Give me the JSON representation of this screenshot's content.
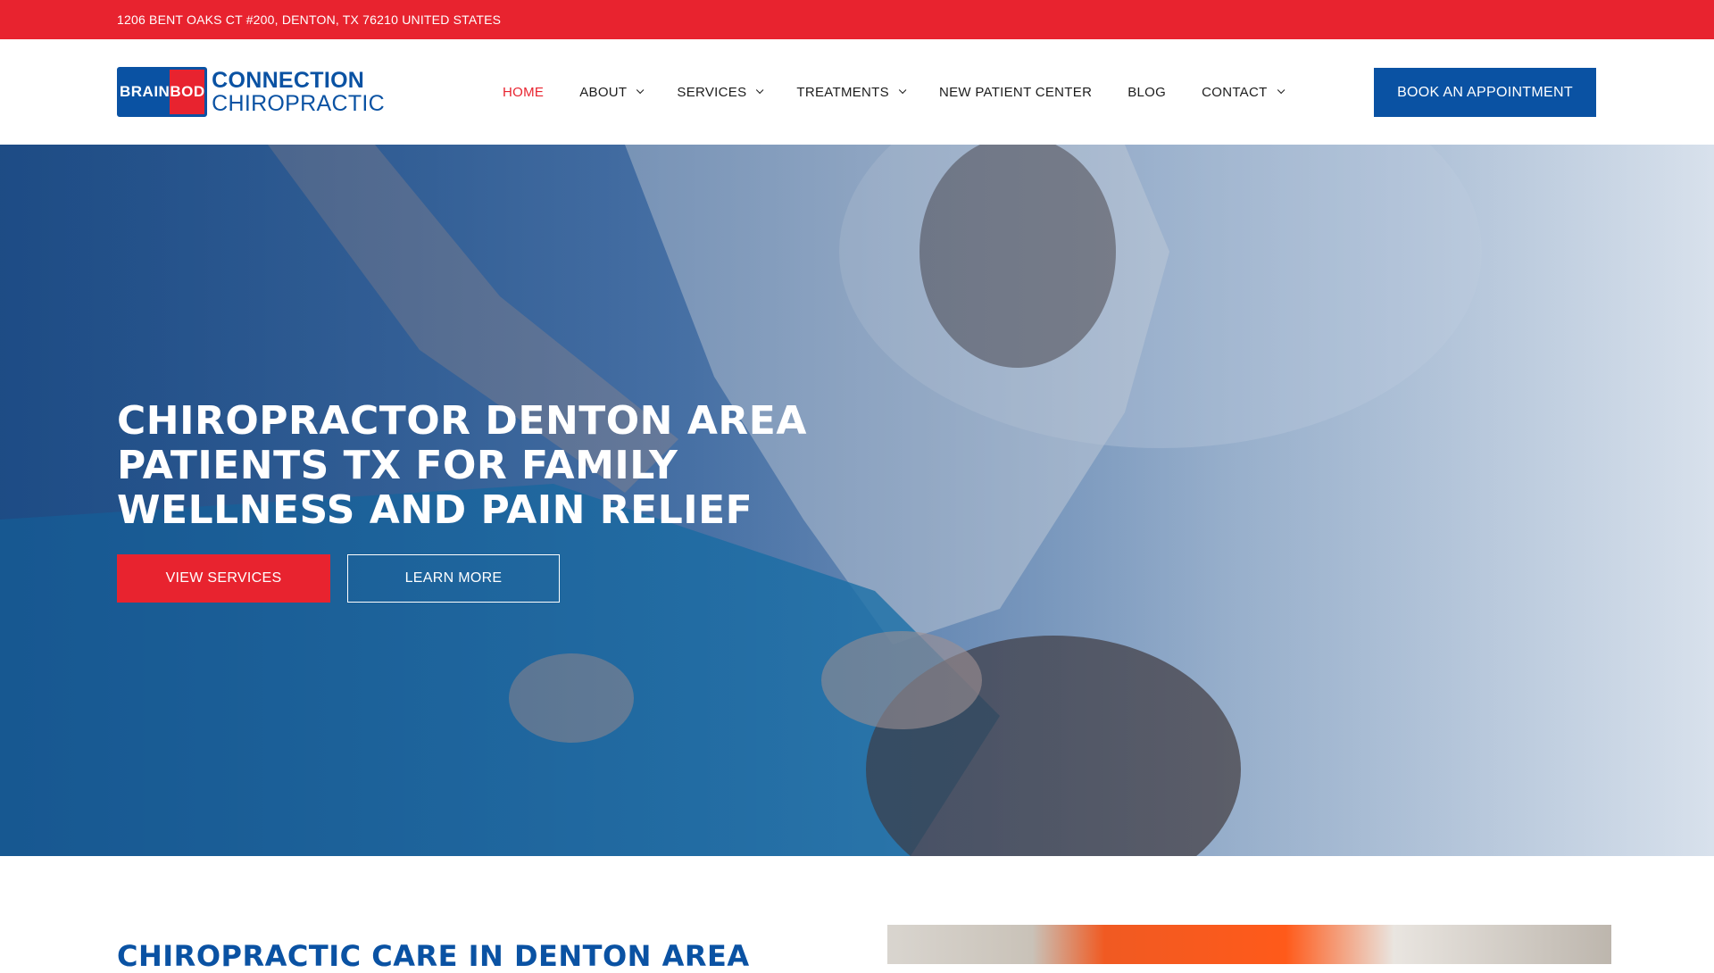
{
  "topbar": {
    "address": "1206 BENT OAKS CT #200, DENTON, TX 76210 UNITED STATES"
  },
  "header": {
    "logo": {
      "badge_left": "BRAIN",
      "badge_right": "BODY",
      "line1": "CONNECTION",
      "line2": "CHIROPRACTIC"
    },
    "nav": [
      {
        "label": "HOME",
        "active": true,
        "dropdown": false
      },
      {
        "label": "ABOUT",
        "active": false,
        "dropdown": true
      },
      {
        "label": "SERVICES",
        "active": false,
        "dropdown": true
      },
      {
        "label": "TREATMENTS",
        "active": false,
        "dropdown": true
      },
      {
        "label": "NEW PATIENT CENTER",
        "active": false,
        "dropdown": false
      },
      {
        "label": "BLOG",
        "active": false,
        "dropdown": false
      },
      {
        "label": "CONTACT",
        "active": false,
        "dropdown": true
      }
    ],
    "cta_label": "BOOK AN APPOINTMENT"
  },
  "hero": {
    "headline": "CHIROPRACTOR DENTON AREA PATIENTS TX FOR FAMILY WELLNESS AND PAIN RELIEF",
    "primary_button": "VIEW SERVICES",
    "secondary_button": "LEARN MORE"
  },
  "section": {
    "title": "CHIROPRACTIC CARE IN DENTON AREA"
  },
  "colors": {
    "brand_red": "#e8232f",
    "brand_blue": "#0a52a3",
    "text_dark": "#1c1c1c",
    "white": "#ffffff"
  },
  "icons": {
    "dropdown": "chevron-down-icon"
  }
}
